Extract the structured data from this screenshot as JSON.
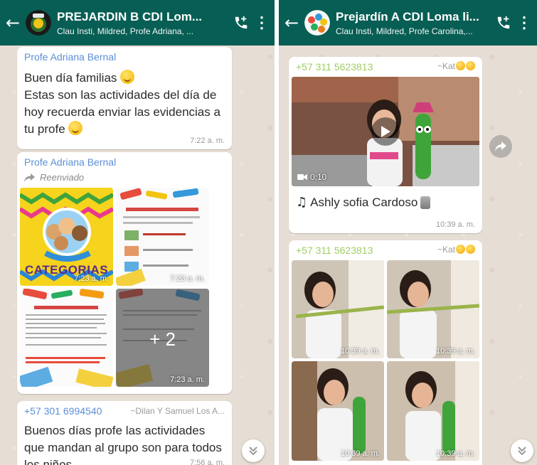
{
  "left_chat": {
    "title": "PREJARDIN B CDI Lom...",
    "subtitle": "Clau Insti, Mildred, Profe Adriana, ...",
    "messages": [
      {
        "sender": "Profe Adriana Bernal",
        "lines": [
          "Buen día familias",
          "Estas son las actividades del día de",
          "hoy recuerda enviar las evidencias a",
          "tu profe"
        ],
        "time": "7:22 a. m."
      },
      {
        "sender": "Profe Adriana Bernal",
        "forwarded_label": "Reenviado",
        "tiles": [
          {
            "text": "CATEGORIAS",
            "time": "7:23 a. m."
          },
          {
            "text": "",
            "time": "7:23 a. m."
          },
          {
            "text": "",
            "time": ""
          },
          {
            "text": "",
            "time": "7:23 a. m."
          }
        ],
        "more_count": "+ 2"
      },
      {
        "sender": "+57 301 6994540",
        "sender_alias": "~Dilan Y Samuel Los A...",
        "lines": [
          "Buenos días profe las actividades",
          "que mandan al grupo son para todos",
          "los niños"
        ],
        "time": "7:56 a. m."
      }
    ]
  },
  "right_chat": {
    "title": "Prejardín A CDI Loma li...",
    "subtitle": "Clau Insti, Mildred, Profe Carolina,...",
    "messages": [
      {
        "sender": "+57 311 5623813",
        "sender_alias": "~Kat",
        "video_duration": "0:10",
        "caption": "Ashly sofia Cardoso",
        "time": "10:39 a. m."
      },
      {
        "sender": "+57 311 5623813",
        "sender_alias": "~Kat",
        "tiles": [
          {
            "time": "10:39 a. m."
          },
          {
            "time": "10:39 a. m."
          },
          {
            "time": "10:39 a. m."
          },
          {
            "time": "10:39 a. m."
          }
        ]
      }
    ]
  },
  "colors": {
    "header": "#075e54",
    "sender_blue": "#5b8fd6",
    "sender_green": "#9fcf61",
    "alias_gray": "#9a9a9a",
    "chat_bg": "#e6ddd4"
  },
  "icons": {
    "back": "arrow-left-icon",
    "add_call": "phone-plus-icon",
    "menu": "more-vert-icon",
    "forward": "forward-icon",
    "scroll_down": "double-chevron-down-icon",
    "video": "video-camera-icon",
    "play": "play-icon"
  }
}
